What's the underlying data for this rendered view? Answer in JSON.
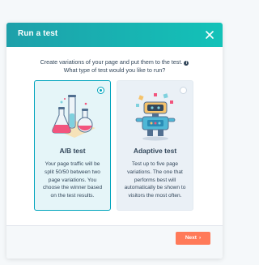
{
  "modal": {
    "title": "Run a test",
    "intro_line1": "Create variations of your page and put them to the test.",
    "intro_line2": "What type of test would you like to run?",
    "info_icon": "info-icon"
  },
  "options": [
    {
      "title": "A/B test",
      "description": "Your page traffic will be split 50/50 between two page variations. You choose the winner based on the test results.",
      "selected": true,
      "icon": "lab-flasks-icon"
    },
    {
      "title": "Adaptive test",
      "description": "Test up to five page variations. The one that performs best will automatically be shown to visitors the most often.",
      "selected": false,
      "icon": "robot-icon"
    }
  ],
  "footer": {
    "next_label": "Next",
    "next_icon": "chevron-right-icon"
  },
  "colors": {
    "header_start": "#1ea0aa",
    "header_end": "#13c2b8",
    "selected_border": "#00a4bd",
    "next_button": "#ff7a59"
  }
}
